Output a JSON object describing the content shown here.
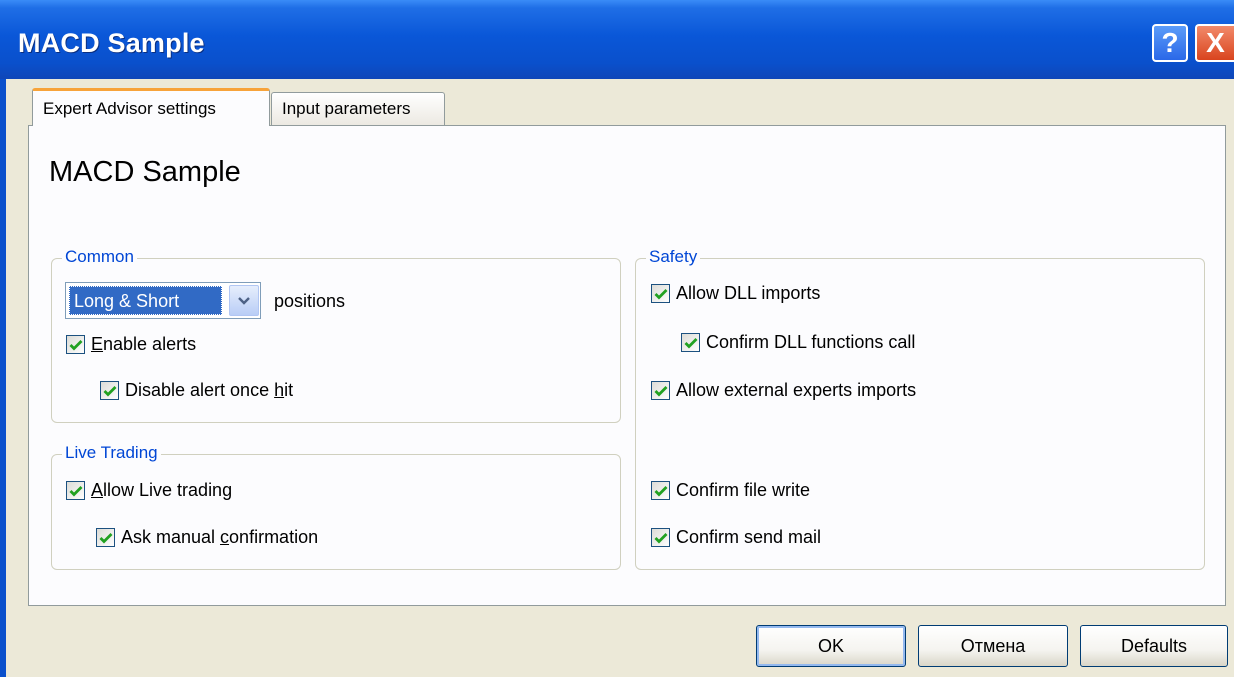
{
  "window": {
    "title": "MACD Sample",
    "help_glyph": "?",
    "close_glyph": "X"
  },
  "tabs": [
    {
      "label": "Expert Advisor settings",
      "active": true
    },
    {
      "label": "Input parameters",
      "active": false
    }
  ],
  "panel": {
    "title": "MACD Sample"
  },
  "common": {
    "label": "Common",
    "positions_select": {
      "value": "Long & Short"
    },
    "positions_label": "positions",
    "enable_alerts": {
      "pre": "",
      "ul": "E",
      "post": "nable alerts",
      "checked": true
    },
    "disable_alert_once_hit": {
      "pre": "Disable alert once ",
      "ul": "h",
      "post": "it",
      "checked": true
    }
  },
  "live_trading": {
    "label": "Live Trading",
    "allow_live_trading": {
      "pre": "",
      "ul": "A",
      "post": "llow Live trading",
      "checked": true
    },
    "ask_manual_confirmation": {
      "pre": "Ask manual ",
      "ul": "c",
      "post": "onfirmation",
      "checked": true
    }
  },
  "safety": {
    "label": "Safety",
    "allow_dll_imports": {
      "label": "Allow DLL imports",
      "checked": true
    },
    "confirm_dll_functions_call": {
      "label": "Confirm DLL functions call",
      "checked": true
    },
    "allow_external_experts_imports": {
      "label": "Allow external experts imports",
      "checked": true
    },
    "confirm_file_write": {
      "label": "Confirm file write",
      "checked": true
    },
    "confirm_send_mail": {
      "label": "Confirm send mail",
      "checked": true
    }
  },
  "buttons": {
    "ok": "OK",
    "cancel": "Отмена",
    "defaults": "Defaults"
  },
  "colors": {
    "title_bar": "#0a50cc",
    "group_label": "#0046d5",
    "check_mark": "#21a121",
    "selection": "#316ac5",
    "tab_accent": "#f7a33a"
  }
}
